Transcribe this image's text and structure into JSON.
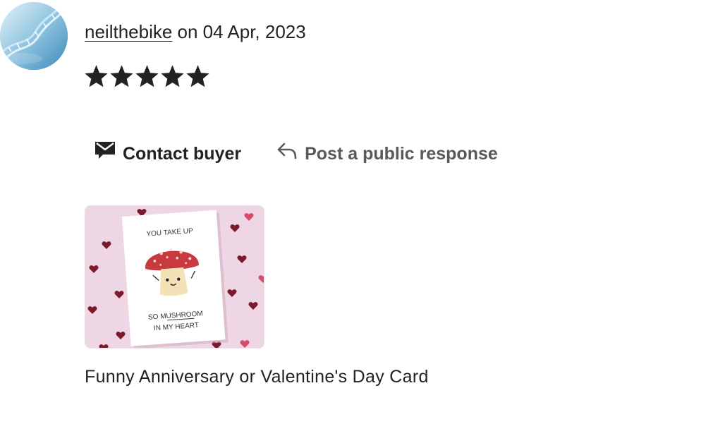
{
  "review": {
    "avatar_icon": "dna-helix-avatar",
    "username": "neilthebike",
    "date_text": " on 04 Apr, 2023",
    "rating": 5,
    "rating_max": 5,
    "star_color": "#222222"
  },
  "actions": {
    "contact_label": "Contact buyer",
    "contact_icon": "envelope-message-icon",
    "respond_label": "Post a public response",
    "respond_icon": "reply-arrow-icon"
  },
  "product": {
    "image_icon": "mushroom-card-image",
    "card_text_top": "YOU TAKE UP",
    "card_text_mid": "SO MUSHROOM",
    "card_text_bottom": "IN MY HEART",
    "title": "Funny Anniversary or Valentine's Day Card"
  }
}
